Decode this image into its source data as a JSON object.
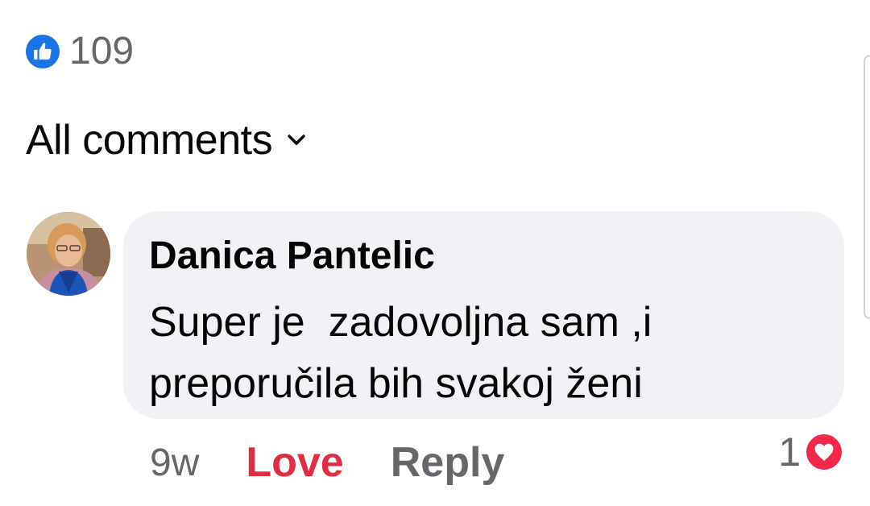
{
  "reactions": {
    "like_count": "109",
    "like_icon": "thumbs-up-icon",
    "like_color": "#1b74e4"
  },
  "filter": {
    "label": "All comments",
    "icon": "chevron-down-icon"
  },
  "comment": {
    "author": "Danica Pantelic",
    "text": "Super je  zadovoljna sam ,i preporučila bih svakoj ženi",
    "time": "9w",
    "love_label": "Love",
    "love_color": "#dd2e44",
    "reply_label": "Reply",
    "reaction_count": "1",
    "reaction_icon": "heart-icon",
    "reaction_color": "#f0284a",
    "bubble_color": "#f0f2f5"
  }
}
